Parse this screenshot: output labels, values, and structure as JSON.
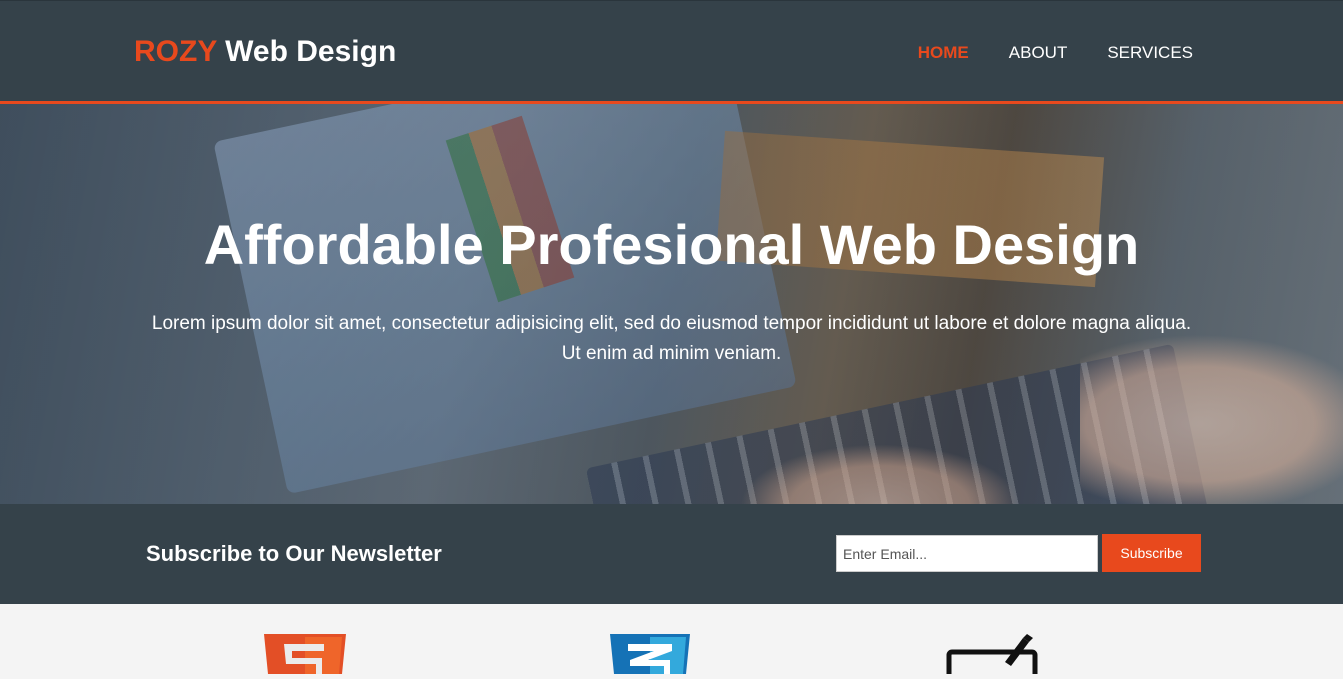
{
  "header": {
    "logo_accent": "ROZY",
    "logo_rest": " Web Design",
    "nav": [
      {
        "label": "HOME",
        "active": true
      },
      {
        "label": "ABOUT",
        "active": false
      },
      {
        "label": "SERVICES",
        "active": false
      }
    ]
  },
  "hero": {
    "title": "Affordable Profesional Web Design",
    "text": "Lorem ipsum dolor sit amet, consectetur adipisicing elit, sed do eiusmod tempor incididunt ut labore et dolore magna aliqua. Ut enim ad minim veniam."
  },
  "newsletter": {
    "title": "Subscribe to Our Newsletter",
    "email_placeholder": "Enter Email...",
    "button_label": "Subscribe"
  },
  "boxes": {
    "icons": [
      "html5-icon",
      "css3-icon",
      "brush-icon"
    ]
  },
  "colors": {
    "accent": "#e8491d",
    "dark": "#35424a",
    "light_bg": "#f4f4f4"
  }
}
